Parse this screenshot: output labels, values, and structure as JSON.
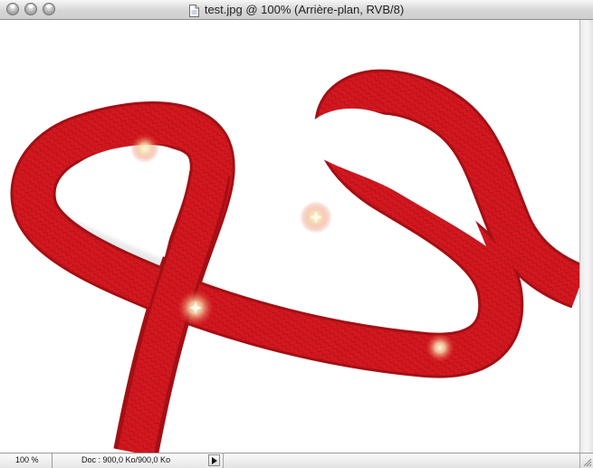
{
  "window": {
    "title": "test.jpg @ 100% (Arrière-plan, RVB/8)",
    "controls": [
      "close",
      "minimize",
      "zoom"
    ]
  },
  "status": {
    "zoom": "100 %",
    "doc_info": "Doc : 900,0 Ko/900,0 Ko"
  },
  "colors": {
    "ribbon": "#d71920",
    "ribbon_dark": "#a80f14",
    "canvas": "#ffffff",
    "sparkle": "#fff3c4"
  },
  "icons": {
    "document": "document-icon",
    "status_menu": "triangle-right-icon"
  }
}
